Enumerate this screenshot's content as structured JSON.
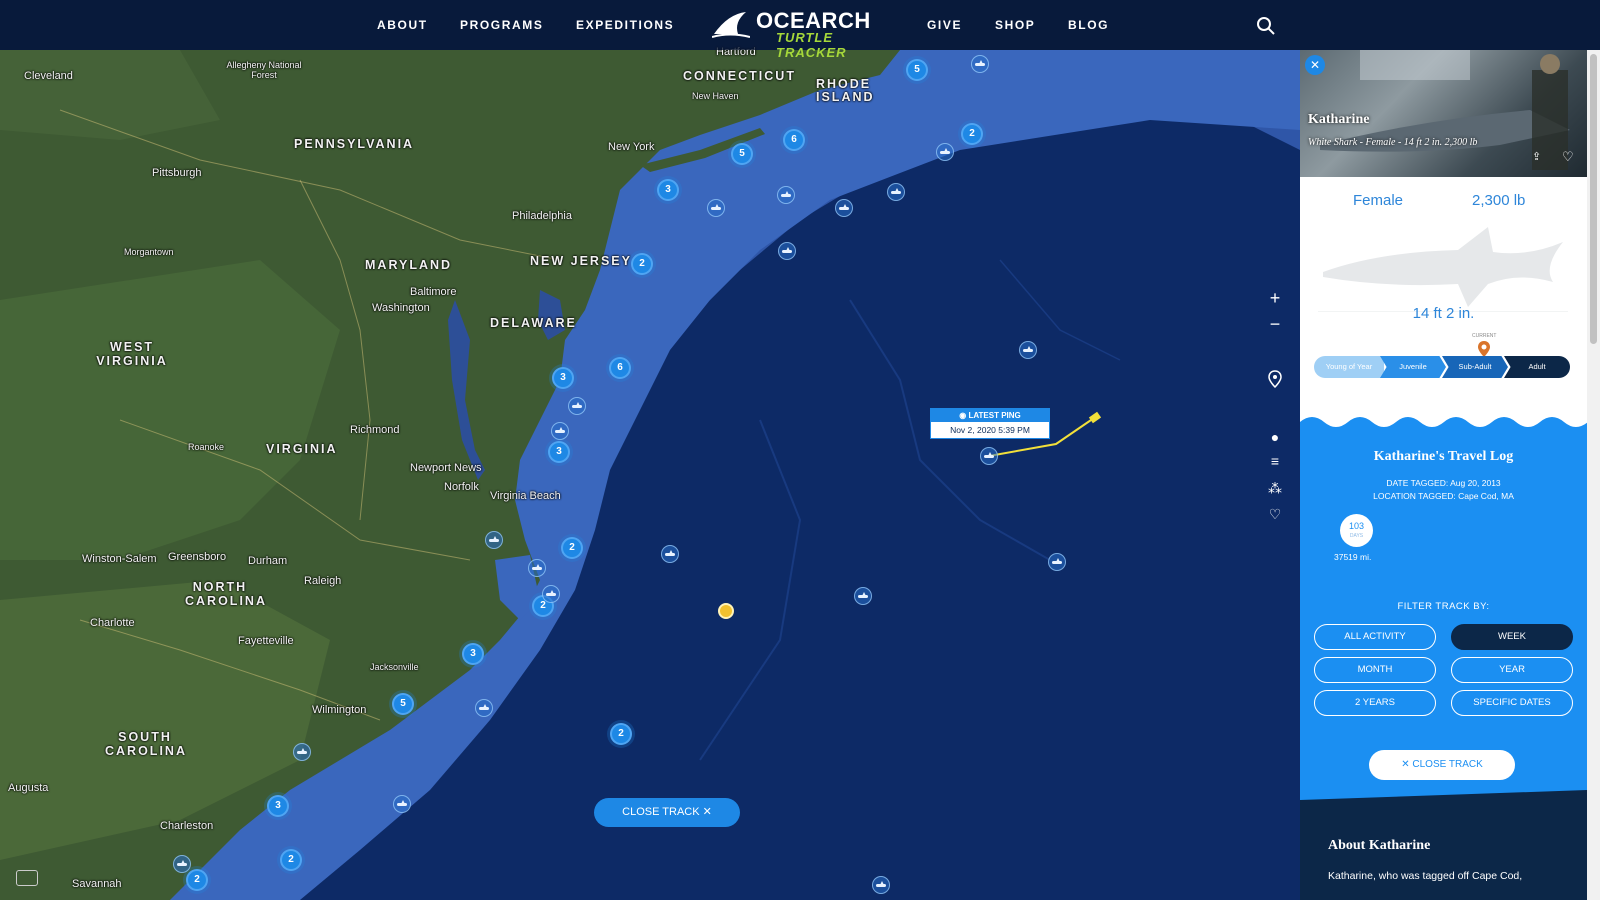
{
  "header": {
    "nav_left": [
      "ABOUT",
      "PROGRAMS",
      "EXPEDITIONS"
    ],
    "nav_right": [
      "GIVE",
      "SHOP",
      "BLOG"
    ],
    "logo_word": "OCEARCH",
    "logo_sub": "TURTLE TRACKER",
    "search_icon": "search-icon"
  },
  "map": {
    "state_labels": [
      "CONNECTICUT",
      "RHODE ISLAND",
      "PENNSYLVANIA",
      "MARYLAND",
      "NEW JERSEY",
      "DELAWARE",
      "WEST VIRGINIA",
      "VIRGINIA",
      "NORTH CAROLINA",
      "SOUTH CAROLINA"
    ],
    "city_labels": [
      "Cleveland",
      "Allegheny National Forest",
      "Hartford",
      "Pittsburgh",
      "New York",
      "Philadelphia",
      "Baltimore",
      "Washington",
      "Newport News",
      "Norfolk",
      "Virginia Beach",
      "Winston-Salem",
      "Greensboro",
      "Durham",
      "Raleigh",
      "Charlotte",
      "Fayetteville",
      "Wilmington",
      "Charleston",
      "Savannah",
      "Augusta",
      "Richmond",
      "New Haven",
      "Morgantown",
      "Roanoke",
      "Jacksonville"
    ],
    "cluster_counts": [
      "5",
      "2",
      "6",
      "5",
      "3",
      "2",
      "6",
      "3",
      "3",
      "2",
      "2",
      "3",
      "5",
      "2",
      "3",
      "2",
      "2"
    ],
    "latest_ping_label": "LATEST PING",
    "latest_ping_time": "Nov 2, 2020 5:39 PM",
    "close_track_label": "CLOSE TRACK",
    "controls": [
      "zoom-in-icon",
      "zoom-out-icon",
      "location-pin-icon",
      "layers-icon",
      "list-icon",
      "share-icon",
      "heart-icon"
    ],
    "colors": {
      "ocean_deep": "#0d2a66",
      "shelf": "#3a63b8",
      "land": "#3e5a33",
      "track": "#f2e03a",
      "cluster": "#1e88e5"
    }
  },
  "panel": {
    "shark_name": "Katharine",
    "shark_desc": "White Shark - Female - 14 ft 2 in. 2,300 lb",
    "gender": "Female",
    "weight": "2,300 lb",
    "length": "14 ft 2 in.",
    "stage_current": "CURRENT",
    "stages": [
      "Young of Year",
      "Juvenile",
      "Sub-Adult",
      "Adult"
    ],
    "travel_log_title": "Katharine's Travel Log",
    "date_tagged": "DATE TAGGED: Aug 20, 2013",
    "location_tagged": "LOCATION TAGGED: Cape Cod, MA",
    "days_value": "103",
    "days_label": "DAYS",
    "miles": "37519 mi.",
    "filter_label": "FILTER TRACK BY:",
    "filters": [
      "ALL ACTIVITY",
      "WEEK",
      "MONTH",
      "YEAR",
      "2 YEARS",
      "SPECIFIC DATES"
    ],
    "active_filter": "WEEK",
    "close_track_label": "CLOSE TRACK",
    "about_title": "About Katharine",
    "about_text": "Katharine, who was tagged off Cape Cod,"
  }
}
